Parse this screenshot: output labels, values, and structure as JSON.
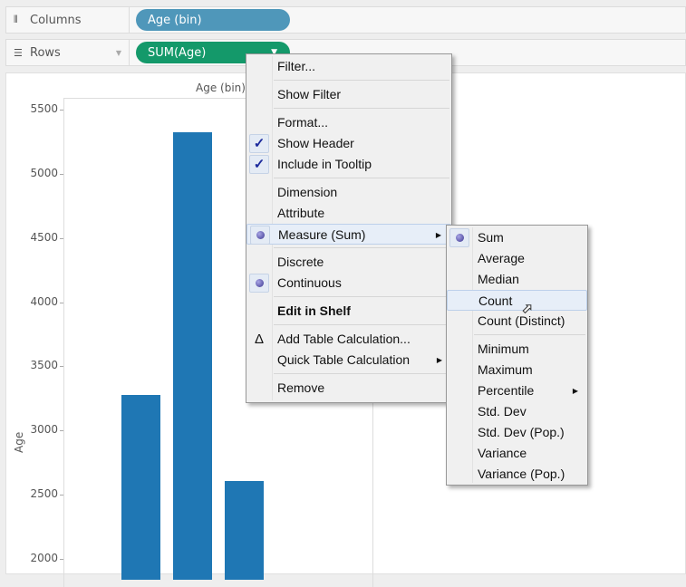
{
  "shelves": {
    "columns": {
      "label": "Columns",
      "icon": "columns-icon",
      "pill": "Age (bin)",
      "pill_color": "#4f97ba"
    },
    "rows": {
      "label": "Rows",
      "icon": "rows-icon",
      "pill": "SUM(Age)",
      "pill_color": "#14996a"
    }
  },
  "chart_data": {
    "type": "bar",
    "title": "Age (bin)",
    "ylabel": "Age",
    "ylim": [
      2000,
      5500
    ],
    "yticks": [
      "5500",
      "5000",
      "4500",
      "4000",
      "3500",
      "3000",
      "2500",
      "2000"
    ],
    "values": [
      3280,
      5325,
      2610
    ],
    "bar_color": "#1f77b4"
  },
  "menu": {
    "items": [
      {
        "label": "Filter..."
      },
      {
        "sep": true
      },
      {
        "label": "Show Filter"
      },
      {
        "sep": true
      },
      {
        "label": "Format..."
      },
      {
        "label": "Show Header",
        "mark": "check"
      },
      {
        "label": "Include in Tooltip",
        "mark": "check"
      },
      {
        "sep": true
      },
      {
        "label": "Dimension"
      },
      {
        "label": "Attribute"
      },
      {
        "label": "Measure (Sum)",
        "mark": "dot",
        "submenu": true,
        "highlight": true
      },
      {
        "sep": true
      },
      {
        "label": "Discrete"
      },
      {
        "label": "Continuous",
        "mark": "dot"
      },
      {
        "sep": true
      },
      {
        "label": "Edit in Shelf",
        "bold": true
      },
      {
        "sep": true
      },
      {
        "label": "Add Table Calculation...",
        "mark": "delta"
      },
      {
        "label": "Quick Table Calculation",
        "submenu": true
      },
      {
        "sep": true
      },
      {
        "label": "Remove"
      }
    ]
  },
  "submenu": {
    "items": [
      {
        "label": "Sum",
        "mark": "dot"
      },
      {
        "label": "Average"
      },
      {
        "label": "Median"
      },
      {
        "label": "Count",
        "highlight": true
      },
      {
        "label": "Count (Distinct)"
      },
      {
        "sep": true
      },
      {
        "label": "Minimum"
      },
      {
        "label": "Maximum"
      },
      {
        "label": "Percentile",
        "submenu": true
      },
      {
        "label": "Std. Dev"
      },
      {
        "label": "Std. Dev (Pop.)"
      },
      {
        "label": "Variance"
      },
      {
        "label": "Variance (Pop.)"
      }
    ]
  }
}
